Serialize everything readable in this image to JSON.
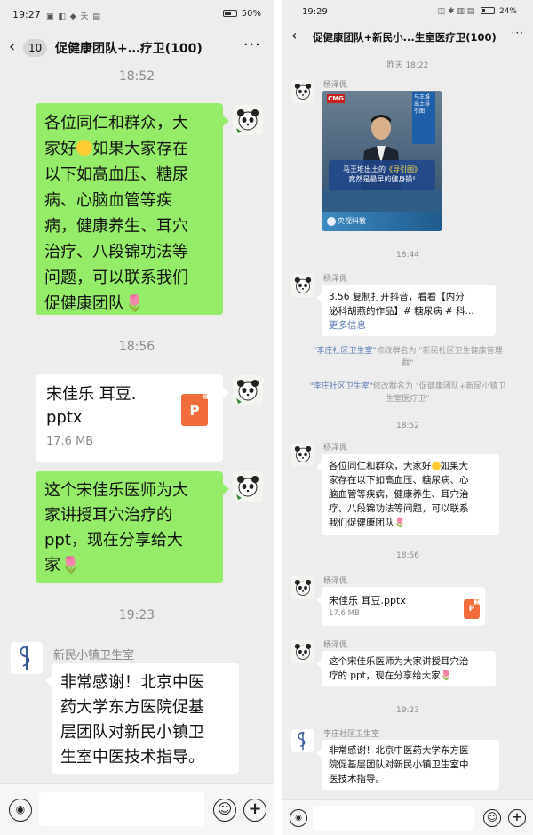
{
  "left": {
    "status": {
      "time": "19:27",
      "icons": "▣ ◧ ◆ 夭 ▤",
      "battery": "50%",
      "battery_level": 0.5
    },
    "header": {
      "unread_count": "10",
      "title": "促健康团队+…疗卫(100)"
    },
    "messages": {
      "time1": "18:52",
      "msg1_line1": "各位同仁和群众，大",
      "msg1_line2a": "家好",
      "msg1_line2b": "如果大家存在",
      "msg1_line3": "以下如高血压、糖尿",
      "msg1_line4": "病、心脑血管等疾",
      "msg1_line5": "病，健康养生、耳穴",
      "msg1_line6": "治疗、八段锦功法等",
      "msg1_line7": "问题，可以联系我们",
      "msg1_line8": "促健康团队",
      "time2": "18:56",
      "file_name_line1": "宋佳乐 耳豆.",
      "file_name_line2": "pptx",
      "file_size": "17.6 MB",
      "file_icon_letter": "P",
      "msg3_line1": "这个宋佳乐医师为大",
      "msg3_line2": "家讲授耳穴治疗的",
      "msg3_line3": "ppt，现在分享给大",
      "msg3_line4": "家",
      "time3": "19:23",
      "sender4": "新民小镇卫生室",
      "msg4_line1": "非常感谢！北京中医",
      "msg4_line2": "药大学东方医院促基",
      "msg4_line3": "层团队对新民小镇卫",
      "msg4_line4": "生室中医技术指导。"
    }
  },
  "right": {
    "status": {
      "time": "19:29",
      "icons": "◫ ✱ ▥ ▤",
      "battery": "24%",
      "battery_level": 0.24
    },
    "header": {
      "title": "促健康团队+新民小...生室医疗卫(100)"
    },
    "messages": {
      "time0": "昨天 18:22",
      "sender_a": "杨泽佩",
      "video_badge": "CMG",
      "video_caption_line1a": "马王堆出土的",
      "video_caption_line1b": "《导引图》",
      "video_caption_line2": "竟然是最早的健身操!",
      "video_footer": "央视科教",
      "video_side": "马王堆出土导引图",
      "time_b": "18:44",
      "sender_b": "杨泽佩",
      "share_line1": "3.56 复制打开抖音，看看【内分",
      "share_line2": "泌科胡燕的作品】# 糖尿病 # 科...",
      "share_more": "更多信息",
      "sys1_name": "\"李庄社区卫生室\"",
      "sys1_text1": "修改群名为 \"新民社区卫生健康管理",
      "sys1_text2": "群\"",
      "sys2_name": "\"李庄社区卫生室\"",
      "sys2_text1": "修改群名为 \"促健康团队+新民小镇卫",
      "sys2_text2": "生室医疗卫\"",
      "time_c": "18:52",
      "sender_c": "杨泽佩",
      "c_line1a": "各位同仁和群众，大家好",
      "c_line1b": "如果大",
      "c_line2": "家存在以下如高血压、糖尿病、心",
      "c_line3": "脑血管等疾病，健康养生、耳穴治",
      "c_line4": "疗、八段锦功法等问题，可以联系",
      "c_line5": "我们促健康团队",
      "time_d": "18:56",
      "sender_d": "杨泽佩",
      "file_name": "宋佳乐 耳豆.pptx",
      "file_size": "17.6 MB",
      "file_icon_letter": "P",
      "sender_e": "杨泽佩",
      "e_line1": "这个宋佳乐医师为大家讲授耳穴治",
      "e_line2": "疗的 ppt，现在分享给大家",
      "time_f": "19:23",
      "sender_f": "李庄社区卫生室",
      "f_line1": "非常感谢！北京中医药大学东方医",
      "f_line2": "院促基层团队对新民小镇卫生室中",
      "f_line3": "医技术指导。"
    }
  },
  "icons": {
    "back": "‹",
    "more": "···",
    "rose": "🌷",
    "voice": "◉",
    "emoji": "☺",
    "plus": "+"
  },
  "colors": {
    "chat_bg": "#ededed",
    "green_bubble": "#95ec69",
    "white_bubble": "#ffffff",
    "file_icon": "#f26b3a",
    "timestamp": "#8a8a8a",
    "system_link": "#5a7bb4"
  }
}
